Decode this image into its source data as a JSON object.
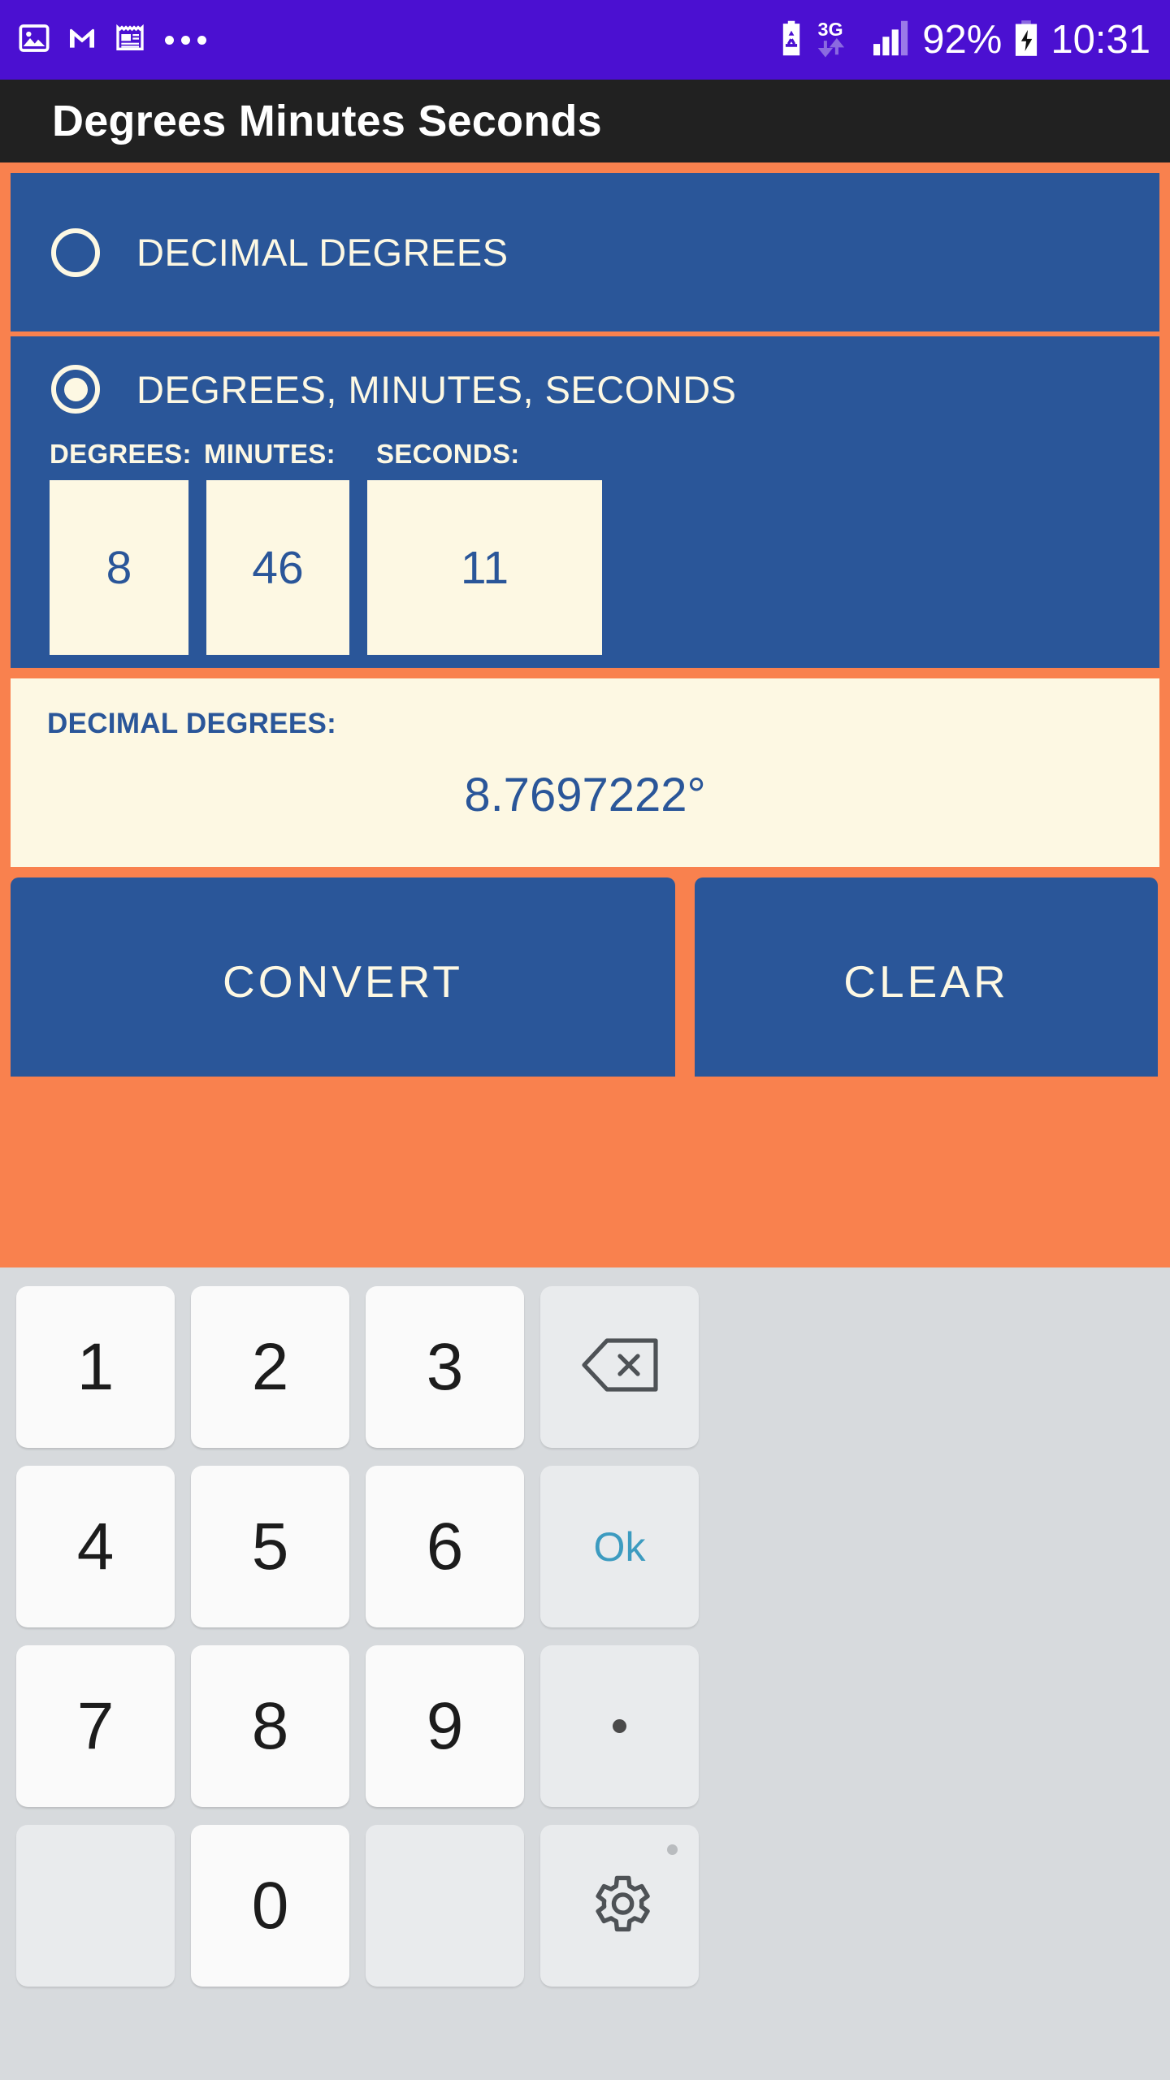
{
  "status_bar": {
    "background_color": "#4b10d1",
    "left_icons": [
      {
        "name": "photos-icon",
        "label": "photos"
      },
      {
        "name": "gmail-icon",
        "label": "M"
      },
      {
        "name": "news-icon",
        "label": "news"
      },
      {
        "name": "more-icons-overflow",
        "label": "..."
      }
    ],
    "right": {
      "battery_saver_icon": "battery-saver-icon",
      "network_type": "3G",
      "signal_icon": "signal-bars-icon",
      "battery_percent": "92%",
      "battery_icon": "battery-charging-icon",
      "time": "10:31"
    }
  },
  "app_bar": {
    "title": "Degrees Minutes Seconds",
    "background_color": "#212121",
    "title_color": "#ffffff"
  },
  "theme": {
    "accent_orange": "#f9814e",
    "panel_blue": "#2a5699",
    "cream": "#fdf8e3",
    "key_teal": "#3c9bc0"
  },
  "form": {
    "option_decimal": {
      "label": "DECIMAL DEGREES",
      "selected": false
    },
    "option_dms": {
      "label": "DEGREES, MINUTES, SECONDS",
      "selected": true
    },
    "fields": [
      {
        "name": "degrees",
        "label": "DEGREES:",
        "value": "8"
      },
      {
        "name": "minutes",
        "label": "MINUTES:",
        "value": "46"
      },
      {
        "name": "seconds",
        "label": "SECONDS:",
        "value": "11"
      }
    ],
    "result": {
      "label": "DECIMAL DEGREES:",
      "value": "8.7697222°"
    },
    "buttons": {
      "convert": "CONVERT",
      "clear": "CLEAR"
    }
  },
  "keyboard": {
    "rows": [
      [
        {
          "name": "key-1",
          "label": "1",
          "type": "num"
        },
        {
          "name": "key-2",
          "label": "2",
          "type": "num"
        },
        {
          "name": "key-3",
          "label": "3",
          "type": "num"
        },
        {
          "name": "key-backspace",
          "label": "",
          "type": "backspace"
        }
      ],
      [
        {
          "name": "key-4",
          "label": "4",
          "type": "num"
        },
        {
          "name": "key-5",
          "label": "5",
          "type": "num"
        },
        {
          "name": "key-6",
          "label": "6",
          "type": "num"
        },
        {
          "name": "key-ok",
          "label": "Ok",
          "type": "ok"
        }
      ],
      [
        {
          "name": "key-7",
          "label": "7",
          "type": "num"
        },
        {
          "name": "key-8",
          "label": "8",
          "type": "num"
        },
        {
          "name": "key-9",
          "label": "9",
          "type": "num"
        },
        {
          "name": "key-period",
          "label": ".",
          "type": "dot"
        }
      ],
      [
        {
          "name": "key-blank-left",
          "label": "",
          "type": "blank"
        },
        {
          "name": "key-0",
          "label": "0",
          "type": "num"
        },
        {
          "name": "key-blank-right",
          "label": "",
          "type": "blank"
        },
        {
          "name": "key-settings",
          "label": "",
          "type": "gear"
        }
      ]
    ]
  }
}
